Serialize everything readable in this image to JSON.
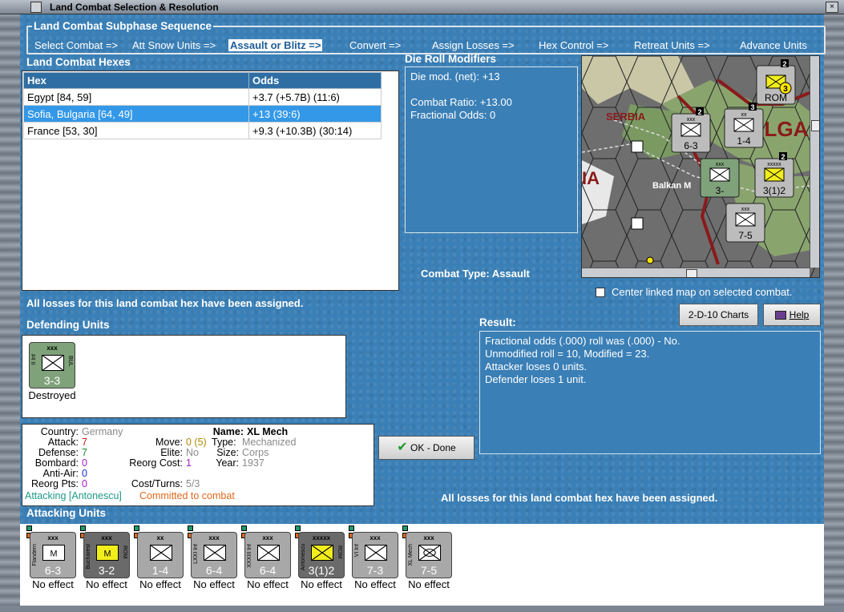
{
  "window": {
    "title": "Land Combat Selection & Resolution",
    "close_glyph": "×"
  },
  "subphase": {
    "title": "Land Combat Subphase Sequence",
    "items": [
      "Select Combat =>",
      "Att Snow Units =>",
      "Assault or Blitz =>",
      "Convert =>",
      "Assign Losses =>",
      "Hex Control =>",
      "Retreat Units =>",
      "Advance Units"
    ],
    "active_index": 2
  },
  "hexes": {
    "title": "Land Combat Hexes",
    "columns": [
      "Hex",
      "Odds"
    ],
    "rows": [
      {
        "hex": "Egypt [84, 59]",
        "odds": "+3.7 (+5.7B) (11:6)",
        "selected": false
      },
      {
        "hex": "Sofia, Bulgaria [64, 49]",
        "odds": "+13 (39:6)",
        "selected": true
      },
      {
        "hex": "France [53, 30]",
        "odds": "+9.3 (+10.3B) (30:14)",
        "selected": false
      }
    ]
  },
  "die_roll": {
    "title": "Die Roll Modifiers",
    "lines": [
      "Die mod. (net): +13",
      "",
      "Combat Ratio: +13.00",
      "Fractional Odds: 0"
    ]
  },
  "combat_type": {
    "label": "Combat Type:",
    "value": "Assault"
  },
  "center_map": {
    "label": "Center linked map on selected combat.",
    "checked": false
  },
  "losses_msg": "All losses for this land combat hex have been assigned.",
  "buttons": {
    "charts": "2-D-10 Charts",
    "help": "Help",
    "ok": "OK - Done"
  },
  "result": {
    "title": "Result:",
    "lines": [
      "Fractional odds (.000) roll was (.000)  - No.",
      "Unmodified roll = 10, Modified = 23.",
      "Attacker loses 0 units.",
      "Defender loses 1 unit."
    ]
  },
  "defending": {
    "title": "Defending Units",
    "units": [
      {
        "size": "xxx",
        "name": "II Inf",
        "nation": "BUL",
        "strength": "3-3",
        "type": "inf",
        "status": "Destroyed"
      }
    ]
  },
  "unit_info": {
    "country_label": "Country:",
    "country": "Germany",
    "attack_label": "Attack:",
    "attack": "7",
    "defense_label": "Defense:",
    "defense": "7",
    "bombard_label": "Bombard:",
    "bombard": "0",
    "antiair_label": "Anti-Air:",
    "antiair": "0",
    "reorg_pts_label": "Reorg Pts:",
    "reorg_pts": "0",
    "name_label": "Name:",
    "name": "XL Mech",
    "move_label": "Move:",
    "move": "0 (5)",
    "type_label": "Type:",
    "type": "Mechanized",
    "elite_label": "Elite:",
    "elite": "No",
    "size_label": "Size:",
    "size": "Corps",
    "reorg_cost_label": "Reorg Cost:",
    "reorg_cost": "1",
    "year_label": "Year:",
    "year": "1937",
    "cost_label": "Cost/Turns:",
    "cost": "5/3",
    "attacking": "Attacking [Antonescu]",
    "committed": "Committed to combat"
  },
  "attacking": {
    "title": "Attacking Units",
    "units": [
      {
        "size": "xxx",
        "name": "Flandern",
        "nation": "",
        "strength": "6-3",
        "type": "mech",
        "color": "#a8a8a8",
        "effect": "No effect"
      },
      {
        "size": "xxx",
        "name": "Bucharest",
        "nation": "ROM",
        "strength": "3-2",
        "type": "mech",
        "color": "#6a6a6a",
        "fill": "#f2ee1c",
        "effect": "No effect"
      },
      {
        "size": "xx",
        "name": "",
        "nation": "",
        "strength": "1-4",
        "type": "inf",
        "color": "#a8a8a8",
        "effect": "No effect"
      },
      {
        "size": "xxx",
        "name": "LXXI Inf",
        "nation": "",
        "strength": "6-4",
        "type": "inf",
        "color": "#a8a8a8",
        "effect": "No effect"
      },
      {
        "size": "xxx",
        "name": "XXXIII Inf",
        "nation": "",
        "strength": "6-4",
        "type": "inf",
        "color": "#a8a8a8",
        "effect": "No effect"
      },
      {
        "size": "xxxxx",
        "name": "Antonescu",
        "nation": "ROM",
        "strength": "3(1)2",
        "type": "inf",
        "color": "#6a6a6a",
        "fill": "#f2ee1c",
        "effect": "No effect"
      },
      {
        "size": "xxx",
        "name": "VI Inf",
        "nation": "",
        "strength": "7-3",
        "type": "inf",
        "color": "#a8a8a8",
        "effect": "No effect"
      },
      {
        "size": "xxx",
        "name": "XL Mech",
        "nation": "",
        "strength": "7-5",
        "type": "armor",
        "color": "#a8a8a8",
        "effect": "No effect"
      }
    ]
  },
  "map": {
    "labels": [
      "SERBIA",
      "BULGARI",
      "IA",
      "Balkan M"
    ],
    "counters": [
      {
        "top": "xxx",
        "str": "6-3",
        "stack": "2"
      },
      {
        "top": "xx",
        "str": "1-4",
        "stack": "3"
      },
      {
        "top": "xxx",
        "str": "3-",
        "stack": ""
      },
      {
        "top": "xxxxx",
        "str": "3(1)2",
        "stack": "2"
      },
      {
        "top": "xxx",
        "str": "7-5",
        "stack": ""
      },
      {
        "top": "",
        "str": "ROM",
        "stack": "2"
      }
    ],
    "corner_badge": "3"
  }
}
